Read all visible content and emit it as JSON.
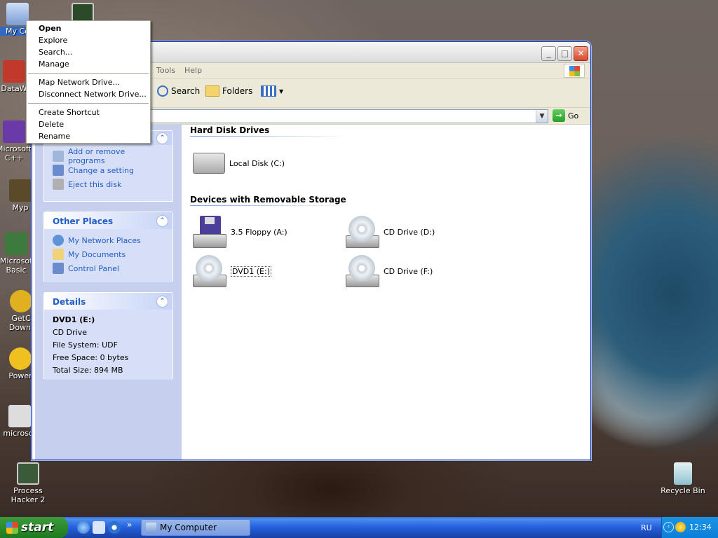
{
  "desktop": {
    "icons": [
      {
        "label": "My Co"
      },
      {
        "label": ""
      },
      {
        "label": "DataW"
      },
      {
        "label": "Microsoft C++"
      },
      {
        "label": "Myp"
      },
      {
        "label": "Microsof Basic"
      },
      {
        "label": "GetC Downl"
      },
      {
        "label": "Power"
      },
      {
        "label": "microsof"
      },
      {
        "label": "Process Hacker 2"
      },
      {
        "label": "Recycle Bin"
      }
    ]
  },
  "context_menu": {
    "items": [
      "Open",
      "Explore",
      "Search...",
      "Manage",
      "Map Network Drive...",
      "Disconnect Network Drive...",
      "Create Shortcut",
      "Delete",
      "Rename"
    ]
  },
  "window": {
    "menu": [
      "Tools",
      "Help"
    ],
    "toolbar": {
      "search": "Search",
      "folders": "Folders"
    },
    "address": {
      "go": "Go"
    },
    "tasks_panel": {
      "links": [
        "Add or remove programs",
        "Change a setting",
        "Eject this disk"
      ]
    },
    "other_places": {
      "title": "Other Places",
      "links": [
        "My Network Places",
        "My Documents",
        "Control Panel"
      ]
    },
    "details": {
      "title": "Details",
      "name": "DVD1 (E:)",
      "type": "CD Drive",
      "filesystem": "File System: UDF",
      "free": "Free Space: 0 bytes",
      "total": "Total Size: 894 MB"
    },
    "content": {
      "section1": "Hard Disk Drives",
      "local_disk": "Local Disk (C:)",
      "section2": "Devices with Removable Storage",
      "floppy": "3.5 Floppy (A:)",
      "cd_d": "CD Drive (D:)",
      "dvd_e": "DVD1 (E:)",
      "cd_f": "CD Drive (F:)"
    }
  },
  "taskbar": {
    "start": "start",
    "task": "My Computer",
    "lang": "RU",
    "clock": "12:34"
  }
}
